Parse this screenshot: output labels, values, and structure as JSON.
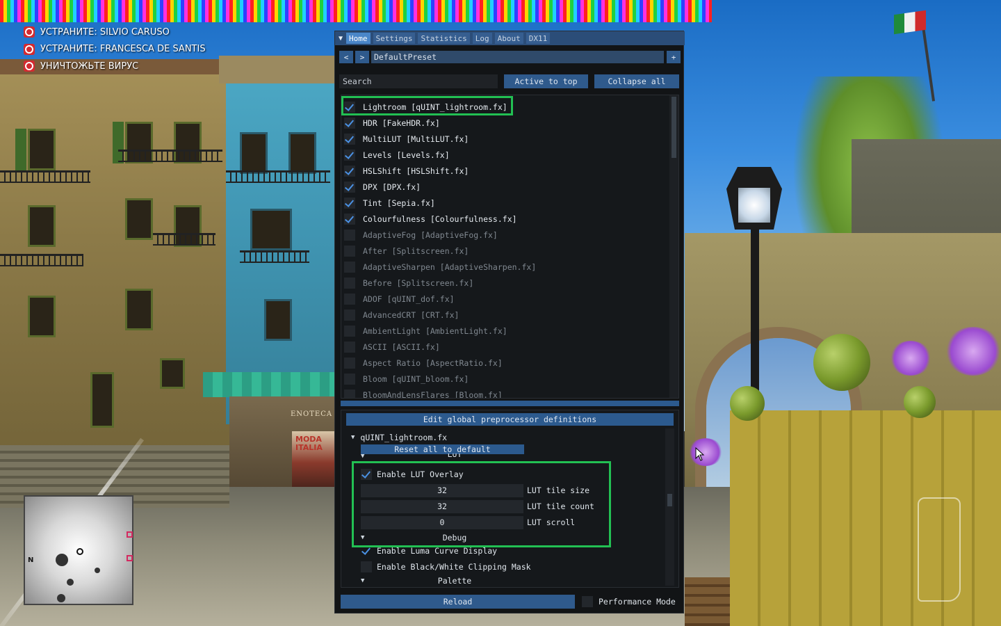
{
  "objectives": [
    {
      "text": "УСТРАНИТЕ: SILVIO CARUSO",
      "icon": "target-icon"
    },
    {
      "text": "УСТРАНИТЕ: FRANCESCA DE SANTIS",
      "icon": "target-icon"
    },
    {
      "text": "УНИЧТОЖЬТЕ ВИРУС",
      "icon": "target-icon"
    }
  ],
  "scene": {
    "shop_sign": "ENOTECA",
    "poster_text": "MODA ITALIA",
    "minimap_north": "N"
  },
  "overlay": {
    "tabs": [
      {
        "label": "Home",
        "active": true
      },
      {
        "label": "Settings",
        "active": false
      },
      {
        "label": "Statistics",
        "active": false
      },
      {
        "label": "Log",
        "active": false
      },
      {
        "label": "About",
        "active": false
      },
      {
        "label": "DX11",
        "active": false
      }
    ],
    "preset": {
      "prev_label": "<",
      "next_label": ">",
      "name": "DefaultPreset",
      "add_label": "+"
    },
    "search": {
      "placeholder": "Search",
      "active_to_top_label": "Active to top",
      "collapse_all_label": "Collapse all"
    },
    "effects": [
      {
        "label": "Lightroom [qUINT_lightroom.fx]",
        "enabled": true
      },
      {
        "label": "HDR [FakeHDR.fx]",
        "enabled": true
      },
      {
        "label": "MultiLUT [MultiLUT.fx]",
        "enabled": true
      },
      {
        "label": "Levels [Levels.fx]",
        "enabled": true
      },
      {
        "label": "HSLShift [HSLShift.fx]",
        "enabled": true
      },
      {
        "label": "DPX [DPX.fx]",
        "enabled": true
      },
      {
        "label": "Tint [Sepia.fx]",
        "enabled": true
      },
      {
        "label": "Colourfulness [Colourfulness.fx]",
        "enabled": true
      },
      {
        "label": "AdaptiveFog [AdaptiveFog.fx]",
        "enabled": false
      },
      {
        "label": "After [Splitscreen.fx]",
        "enabled": false
      },
      {
        "label": "AdaptiveSharpen [AdaptiveSharpen.fx]",
        "enabled": false
      },
      {
        "label": "Before [Splitscreen.fx]",
        "enabled": false
      },
      {
        "label": "ADOF [qUINT_dof.fx]",
        "enabled": false
      },
      {
        "label": "AdvancedCRT [CRT.fx]",
        "enabled": false
      },
      {
        "label": "AmbientLight [AmbientLight.fx]",
        "enabled": false
      },
      {
        "label": "ASCII [ASCII.fx]",
        "enabled": false
      },
      {
        "label": "Aspect Ratio [AspectRatio.fx]",
        "enabled": false
      },
      {
        "label": "Bloom [qUINT_bloom.fx]",
        "enabled": false
      },
      {
        "label": "BloomAndLensFlares [Bloom.fx]",
        "enabled": false
      }
    ],
    "settings": {
      "edit_preprocessor_label": "Edit global preprocessor definitions",
      "effect_file": "qUINT_lightroom.fx",
      "reset_label": "Reset all to default",
      "lut_section": "LUT",
      "enable_lut_overlay": {
        "label": "Enable LUT Overlay",
        "checked": true
      },
      "lut_tile_size": {
        "value": "32",
        "label": "LUT tile size"
      },
      "lut_tile_count": {
        "value": "32",
        "label": "LUT tile count"
      },
      "lut_scroll": {
        "value": "0",
        "label": "LUT scroll"
      },
      "debug_section": "Debug",
      "enable_luma_curve": {
        "label": "Enable Luma Curve Display",
        "checked": true
      },
      "enable_clipping_mask": {
        "label": "Enable Black/White Clipping Mask",
        "checked": false
      },
      "palette_section": "Palette"
    },
    "reload_label": "Reload",
    "performance_mode_label": "Performance Mode"
  },
  "colors": {
    "accent_blue": "#2c5a8e",
    "check_blue": "#4a90e2",
    "highlight_green": "#22c053",
    "objective_red": "#d42a30"
  }
}
